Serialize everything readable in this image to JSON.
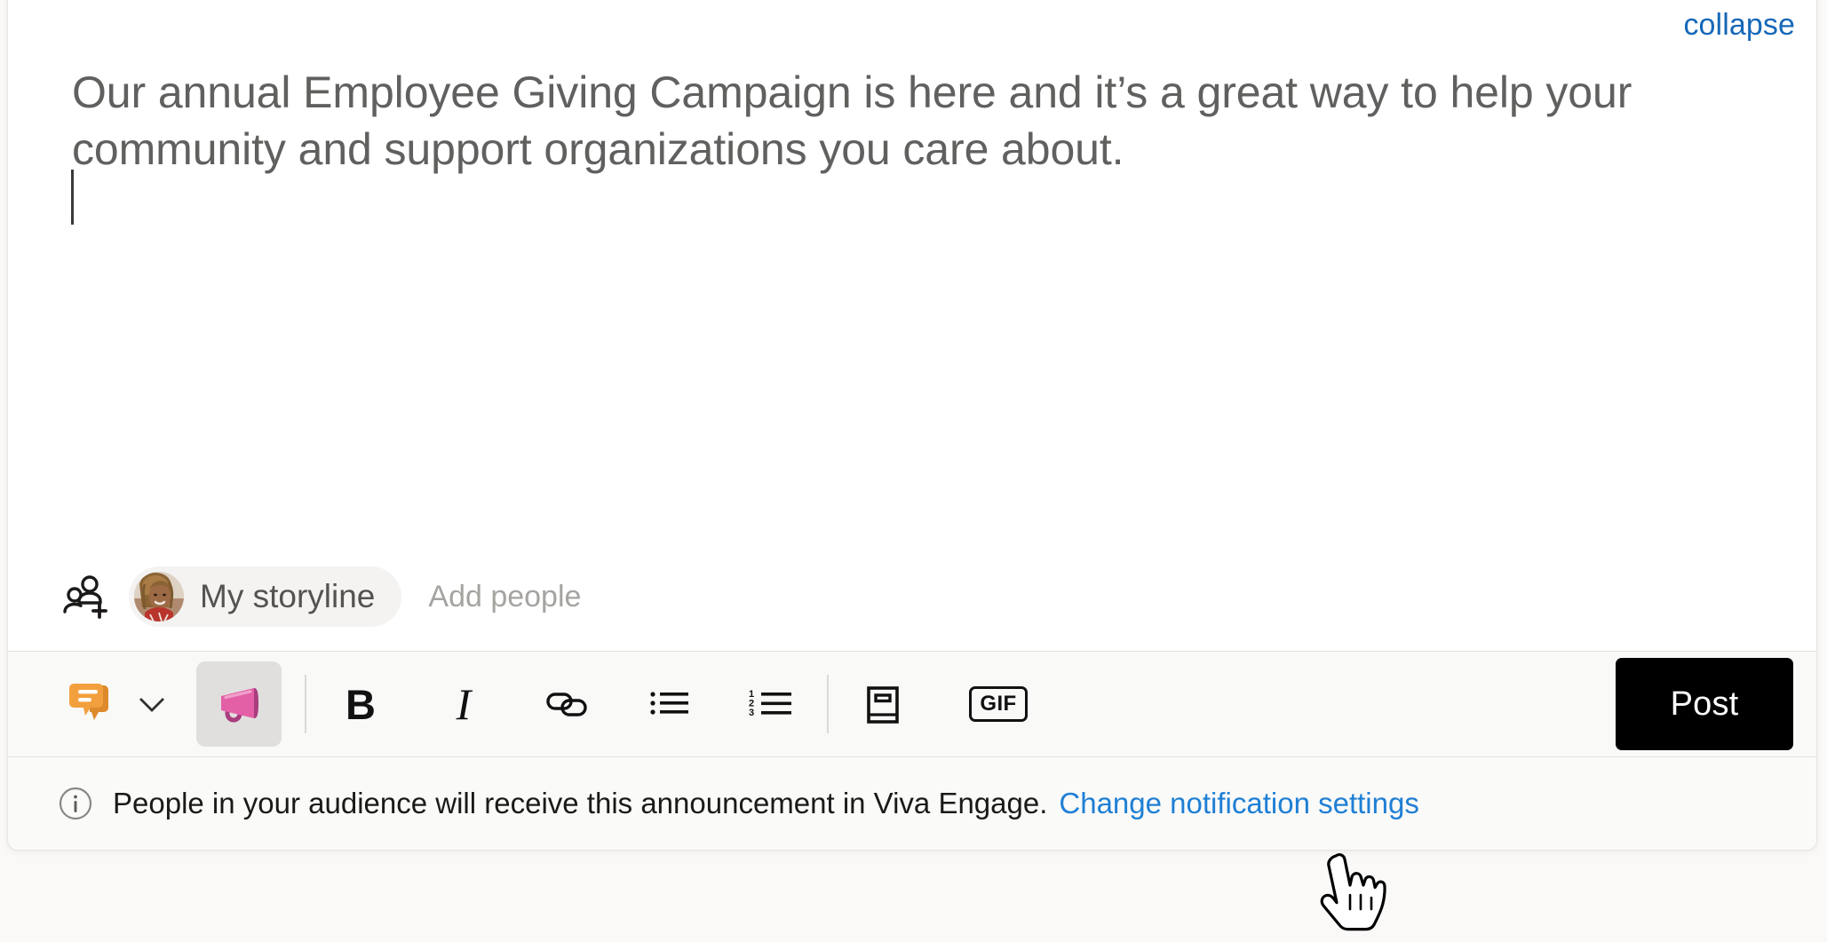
{
  "card": {
    "collapse_label": "collapse"
  },
  "editor": {
    "content": "Our annual Employee Giving Campaign is here and it’s a great way to help your community and support organizations you care about.",
    "caret_visible": true
  },
  "audience": {
    "people_icon": "add-people-icon",
    "avatar_icon": "user-avatar-photo",
    "selected_audience": "My storyline",
    "add_people_placeholder": "Add people"
  },
  "toolbar": {
    "items": [
      {
        "name": "post-type-discussion-icon",
        "label": "Discussion",
        "icon": "discussion-bubbles-icon",
        "selected": false
      },
      {
        "name": "post-type-dropdown",
        "label": "",
        "icon": "chevron-down-icon",
        "selected": false
      },
      {
        "name": "post-type-announcement",
        "label": "Announcement",
        "icon": "megaphone-icon",
        "selected": true
      },
      {
        "name": "bold-button",
        "label": "B",
        "icon": "bold-icon",
        "selected": false
      },
      {
        "name": "italic-button",
        "label": "I",
        "icon": "italic-icon",
        "selected": false
      },
      {
        "name": "link-button",
        "label": "Link",
        "icon": "link-chain-icon",
        "selected": false
      },
      {
        "name": "bulleted-list-button",
        "label": "Bulleted list",
        "icon": "bulleted-list-icon",
        "selected": false
      },
      {
        "name": "numbered-list-button",
        "label": "Numbered list",
        "icon": "numbered-list-icon",
        "selected": false
      },
      {
        "name": "praise-button",
        "label": "Praise",
        "icon": "book-icon",
        "selected": false
      },
      {
        "name": "gif-button",
        "label": "GIF",
        "icon": "gif-icon",
        "selected": false
      }
    ],
    "gif_label": "GIF",
    "bold_label": "B",
    "italic_label": "I",
    "post_label": "Post"
  },
  "notice": {
    "icon": "info-circle-icon",
    "message": "People in your audience will receive this announcement in Viva Engage.",
    "link_label": "Change notification settings"
  },
  "cursor": {
    "icon": "pointing-hand-cursor"
  },
  "colors": {
    "link_blue": "#1668b8",
    "notice_link_blue": "#1f7fd4",
    "post_button_bg": "#000000",
    "post_button_text": "#ffffff",
    "editor_text": "#60605e",
    "toolbar_bg": "#f9f9f8",
    "selected_tool_bg": "#e1dfde",
    "megaphone_pink": "#e35fa6",
    "megaphone_dark": "#a93d7e",
    "discussion_orange": "#f0a03c",
    "discussion_orange_dark": "#e08a2e"
  }
}
